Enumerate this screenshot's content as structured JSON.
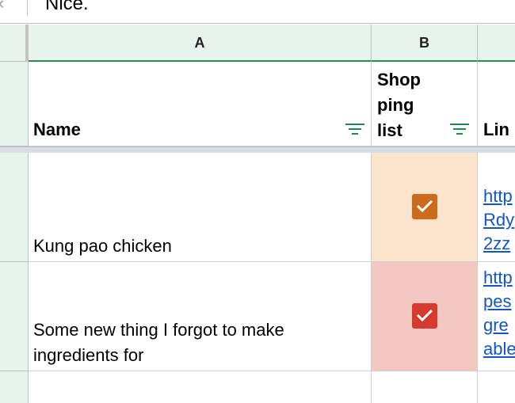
{
  "formula_bar": {
    "value": "Nice."
  },
  "columns": [
    {
      "letter": "A"
    },
    {
      "letter": "B"
    },
    {
      "letter": ""
    }
  ],
  "header_row": {
    "name": "Name",
    "shopping_list": [
      "Shop",
      "ping",
      "list"
    ],
    "link": "Lin"
  },
  "rows": [
    {
      "name": "Kung pao chicken",
      "shopping_list_checked": true,
      "status_color": "#fce4cc",
      "checkbox_color": "#cc6b1c",
      "link_lines": [
        "http",
        "Rdy",
        "2zz"
      ]
    },
    {
      "name": "Some new thing I forgot to make ingredients for",
      "shopping_list_checked": true,
      "status_color": "#f4c7c3",
      "checkbox_color": "#d63a2f",
      "link_lines": [
        "http",
        "pes",
        "gre",
        "able"
      ]
    }
  ],
  "colors": {
    "header_bg": "#e6f4ec",
    "header_border": "#2e8b57",
    "filter_icon": "#1e8a4a",
    "link": "#1155cc"
  }
}
